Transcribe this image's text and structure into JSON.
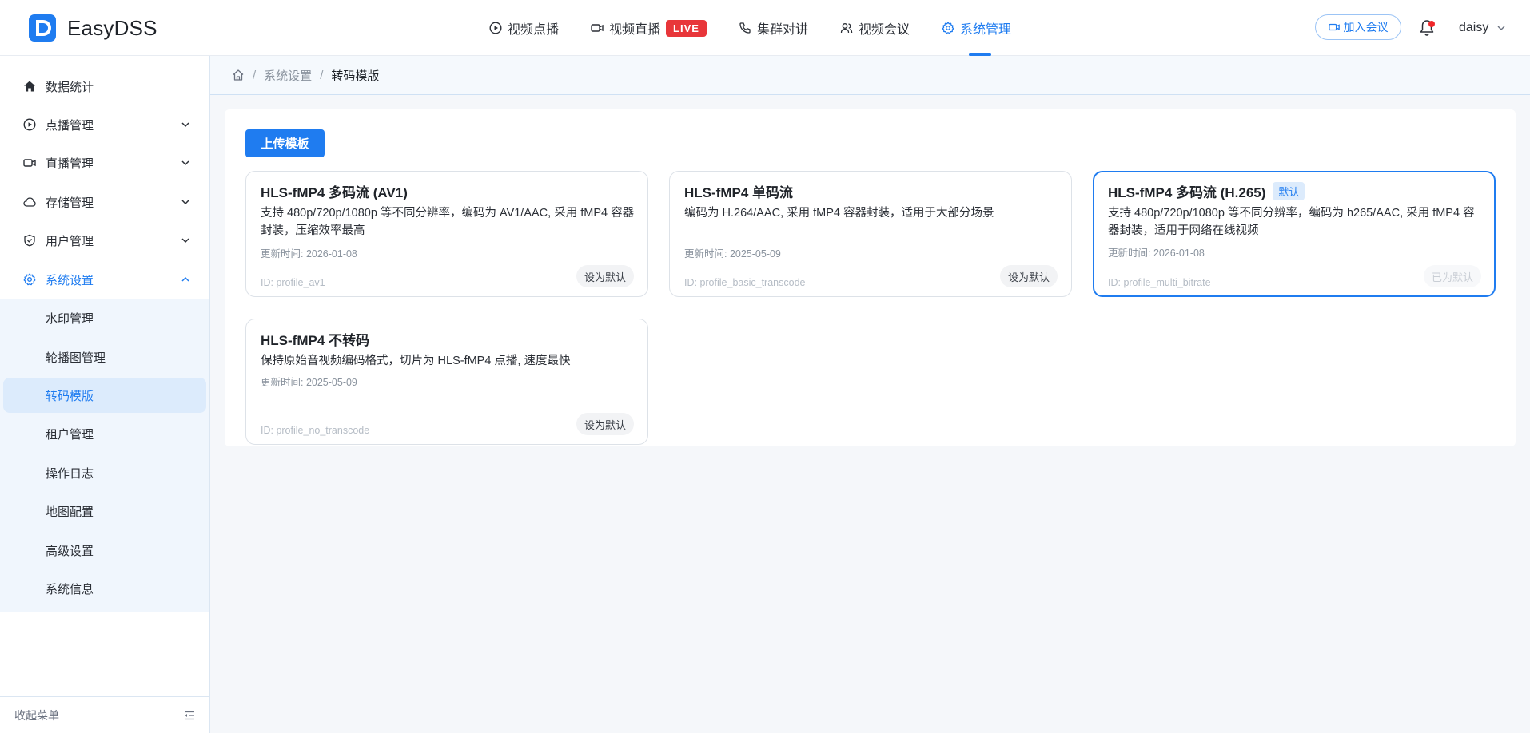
{
  "app": {
    "name": "EasyDSS"
  },
  "nav": {
    "items": [
      {
        "label": "视频点播",
        "icon": "play-circle-icon"
      },
      {
        "label": "视频直播",
        "icon": "video-camera-icon",
        "badge": "LIVE"
      },
      {
        "label": "集群对讲",
        "icon": "phone-icon"
      },
      {
        "label": "视频会议",
        "icon": "users-icon"
      },
      {
        "label": "系统管理",
        "icon": "gear-icon",
        "active": true
      }
    ],
    "join_button": "加入会议",
    "user": "daisy"
  },
  "sidebar": {
    "items": [
      {
        "label": "数据统计",
        "icon": "home-icon"
      },
      {
        "label": "点播管理",
        "icon": "play-circle-icon"
      },
      {
        "label": "直播管理",
        "icon": "video-camera-icon"
      },
      {
        "label": "存储管理",
        "icon": "cloud-icon"
      },
      {
        "label": "用户管理",
        "icon": "shield-icon"
      },
      {
        "label": "系统设置",
        "icon": "gear-icon",
        "expanded": true
      }
    ],
    "submenu": [
      {
        "label": "水印管理"
      },
      {
        "label": "轮播图管理"
      },
      {
        "label": "转码模版",
        "active": true
      },
      {
        "label": "租户管理"
      },
      {
        "label": "操作日志"
      },
      {
        "label": "地图配置"
      },
      {
        "label": "高级设置"
      },
      {
        "label": "系统信息"
      }
    ],
    "collapse_label": "收起菜单"
  },
  "breadcrumb": {
    "items": [
      "系统设置",
      "转码模版"
    ]
  },
  "main": {
    "upload_button": "上传模板",
    "cards": [
      {
        "title": "HLS-fMP4 多码流 (AV1)",
        "desc": "支持 480p/720p/1080p 等不同分辨率，编码为 AV1/AAC, 采用 fMP4 容器封装，压缩效率最高",
        "time": "更新时间: 2026-01-08",
        "id": "ID: profile_av1",
        "button": "设为默认"
      },
      {
        "title": "HLS-fMP4 单码流",
        "desc": "编码为 H.264/AAC, 采用 fMP4 容器封装，适用于大部分场景",
        "time": "更新时间: 2025-05-09",
        "id": "ID: profile_basic_transcode",
        "button": "设为默认"
      },
      {
        "title": "HLS-fMP4 多码流 (H.265)",
        "tag": "默认",
        "desc": "支持 480p/720p/1080p 等不同分辨率，编码为 h265/AAC, 采用 fMP4 容器封装，适用于网络在线视频",
        "time": "更新时间: 2026-01-08",
        "id": "ID: profile_multi_bitrate",
        "button": "已为默认",
        "selected": true
      },
      {
        "title": "HLS-fMP4 不转码",
        "desc": "保持原始音视频编码格式，切片为 HLS-fMP4 点播, 速度最快",
        "time": "更新时间: 2025-05-09",
        "id": "ID: profile_no_transcode",
        "button": "设为默认"
      }
    ]
  },
  "colors": {
    "accent": "#1f7cf0",
    "live": "#e8363a",
    "submenu_bg": "#f0f6fd",
    "active_bg": "#dcebfc"
  }
}
